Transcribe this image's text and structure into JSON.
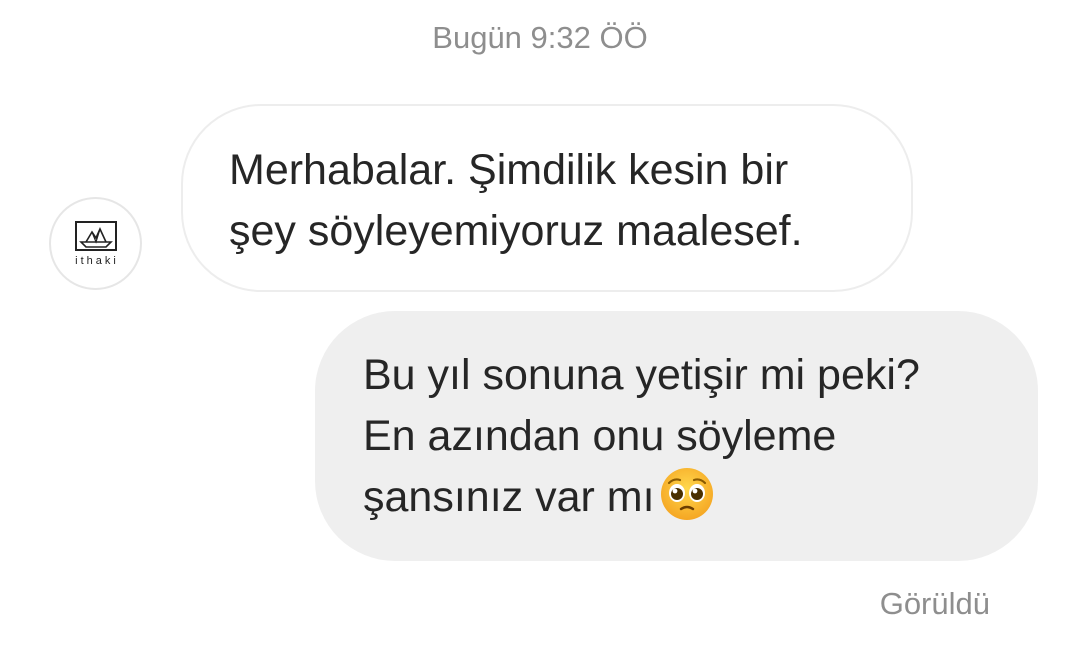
{
  "chat": {
    "timestamp": "Bugün 9:32 ÖÖ",
    "contact": {
      "avatar_label": "ithaki"
    },
    "messages": [
      {
        "direction": "incoming",
        "lines": [
          "Merhabalar. Şimdilik kesin bir",
          "şey söyleyemiyoruz maalesef."
        ]
      },
      {
        "direction": "outgoing",
        "lines": [
          "Bu yıl sonuna yetişir mi peki?",
          "En azından onu söyleme",
          "şansınız var mı"
        ],
        "emoji": "pleading-face-emoji"
      }
    ],
    "seen_status": "Görüldü"
  }
}
